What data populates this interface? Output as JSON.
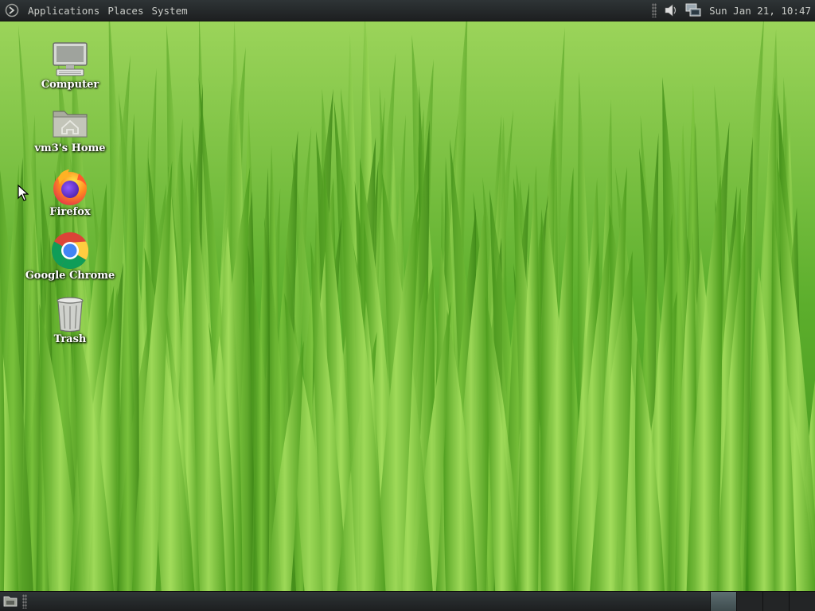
{
  "top_panel": {
    "logo_icon": "mate-menu-icon",
    "menus": [
      {
        "label": "Applications"
      },
      {
        "label": "Places"
      },
      {
        "label": "System"
      }
    ],
    "tray_icons": [
      "volume-icon",
      "network-icon"
    ],
    "clock": "Sun Jan 21, 10:47"
  },
  "desktop": {
    "wallpaper": "green-grass",
    "icons": [
      {
        "label": "Computer",
        "icon": "computer-icon"
      },
      {
        "label": "vm3's Home",
        "icon": "home-folder-icon"
      },
      {
        "label": "Firefox",
        "icon": "firefox-icon"
      },
      {
        "label": "Google Chrome",
        "icon": "chrome-icon"
      },
      {
        "label": "Trash",
        "icon": "trash-icon"
      }
    ]
  },
  "bottom_panel": {
    "show_desktop_icon": "show-desktop-icon",
    "workspaces": [
      {
        "active": true
      },
      {
        "active": false
      },
      {
        "active": false
      },
      {
        "active": false
      }
    ]
  },
  "colors": {
    "panel_bg": "#2e3436",
    "panel_text": "#c9cbc7",
    "grass_light": "#8fd14f",
    "grass_dark": "#2f7a12"
  }
}
